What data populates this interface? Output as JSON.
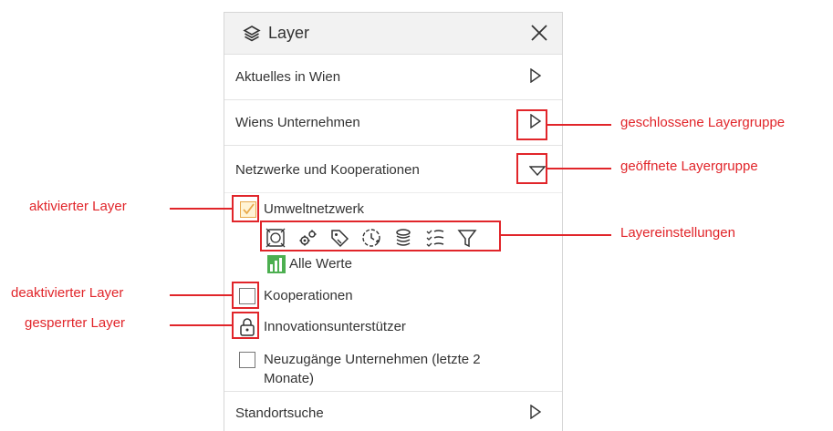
{
  "panel": {
    "title": "Layer",
    "groups": [
      {
        "label": "Aktuelles in Wien",
        "state": "closed"
      },
      {
        "label": "Wiens Unternehmen",
        "state": "closed"
      },
      {
        "label": "Netzwerke und Kooperationen",
        "state": "open"
      },
      {
        "label": "Standortsuche",
        "state": "closed"
      }
    ],
    "layers": {
      "umwelt": {
        "label": "Umweltnetzwerk",
        "checked": true
      },
      "alle_werte": "Alle Werte",
      "kooperationen": {
        "label": "Kooperationen",
        "checked": false
      },
      "innovation": {
        "label": "Innovationsunterstützer",
        "locked": true
      },
      "neuzugaenge": {
        "label_line1": "Neuzugänge Unternehmen (letzte 2",
        "label_line2": "Monate)",
        "checked": false
      }
    },
    "tool_icons": [
      "map-frame-icon",
      "settings-gears-icon",
      "tag-icon",
      "clock-plus-icon",
      "stack-icon",
      "list-filter-icon",
      "funnel-icon"
    ]
  },
  "annotations": {
    "closed_group": "geschlossene Layergruppe",
    "open_group": "geöffnete Layergruppe",
    "layer_settings": "Layereinstellungen",
    "active_layer": "aktivierter Layer",
    "inactive_layer": "deaktivierter Layer",
    "locked_layer": "gesperrter Layer"
  },
  "colors": {
    "annotation": "#e1252a",
    "checked_fill": "#fff4d6",
    "checked_mark": "#e8a94a",
    "legend_green": "#4caf50"
  }
}
